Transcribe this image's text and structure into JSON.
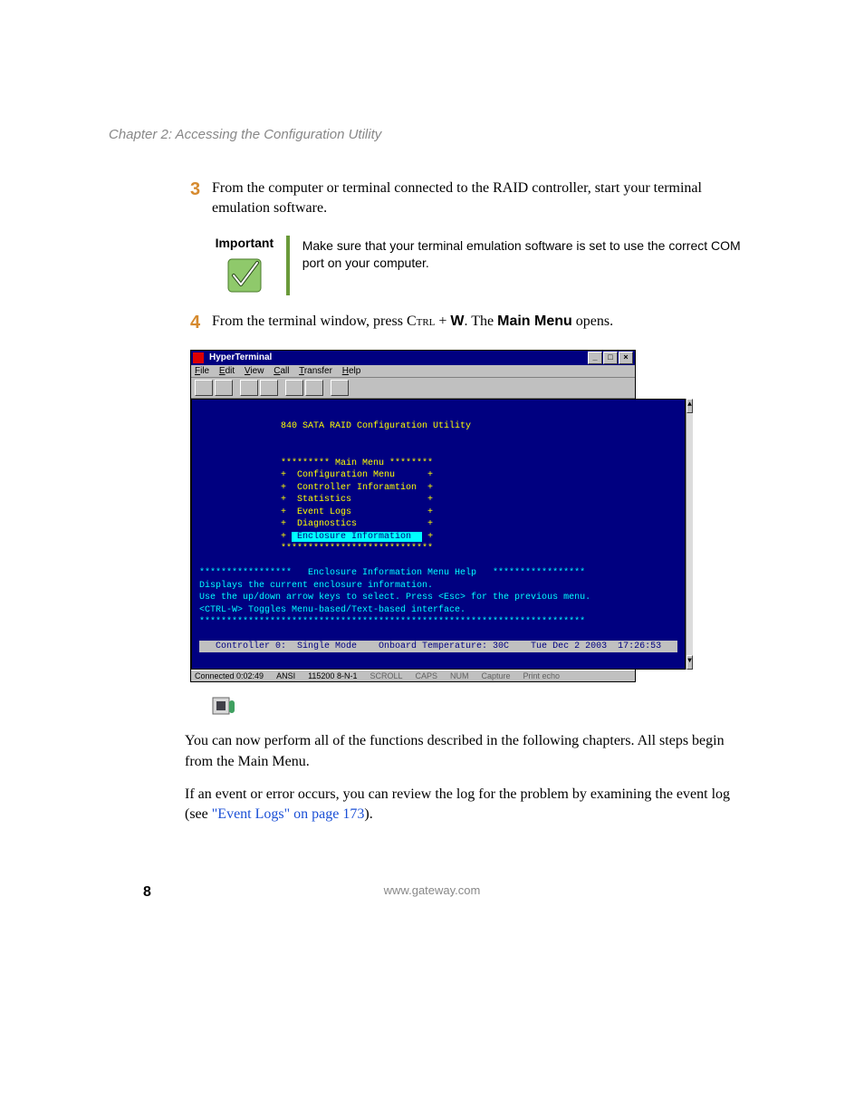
{
  "chapter_header": "Chapter 2: Accessing the Configuration Utility",
  "step3": {
    "num": "3",
    "text": "From the computer or terminal connected to the RAID controller, start your terminal emulation software."
  },
  "important": {
    "label": "Important",
    "text": "Make sure that your terminal emulation software is set to use the correct COM port on your computer."
  },
  "step4": {
    "num": "4",
    "text_before": "From the terminal window, press ",
    "key_ctrl": "Ctrl",
    "plus": " + ",
    "key_w": "W",
    "text_mid": ". The ",
    "main_menu": "Main Menu",
    "text_after": " opens."
  },
  "hyperterm": {
    "app_title": "HyperTerminal",
    "menu": {
      "file": "File",
      "edit": "Edit",
      "view": "View",
      "call": "Call",
      "transfer": "Transfer",
      "help": "Help"
    },
    "win_min": "_",
    "win_max": "□",
    "win_close": "×",
    "term": {
      "title_line": "               840 SATA RAID Configuration Utility",
      "mm_header": "               ********* Main Menu ********",
      "mm1": "               +  Configuration Menu      +",
      "mm2": "               +  Controller Inforamtion  +",
      "mm3": "               +  Statistics              +",
      "mm4": "               +  Event Logs              +",
      "mm5": "               +  Diagnostics             +",
      "mm6_pre": "               + ",
      "mm6_hi": " Enclosure Information  ",
      "mm6_post": " +",
      "mm_footer": "               ****************************",
      "help_header": "*****************   Enclosure Information Menu Help   *****************",
      "help1": "Displays the current enclosure information.",
      "help2": "Use the up/down arrow keys to select. Press <Esc> for the previous menu.",
      "help3": "<CTRL-W> Toggles Menu-based/Text-based interface.",
      "help_stars": "***********************************************************************",
      "statline": "  Controller 0:  Single Mode    Onboard Temperature: 30C    Tue Dec 2 2003  17:26:53  "
    },
    "status": {
      "connected": "Connected 0:02:49",
      "encoding": "ANSI",
      "settings": "115200 8-N-1",
      "scroll": "SCROLL",
      "caps": "CAPS",
      "num": "NUM",
      "capture": "Capture",
      "printecho": "Print echo"
    }
  },
  "para1": "You can now perform all of the functions described in the following chapters. All steps begin from the Main Menu.",
  "para2_before": "If an event or error occurs, you can review the log for the problem by examining the event log (see ",
  "para2_link": "\"Event Logs\" on page 173",
  "para2_after": ").",
  "footer_url": "www.gateway.com",
  "page_number": "8"
}
